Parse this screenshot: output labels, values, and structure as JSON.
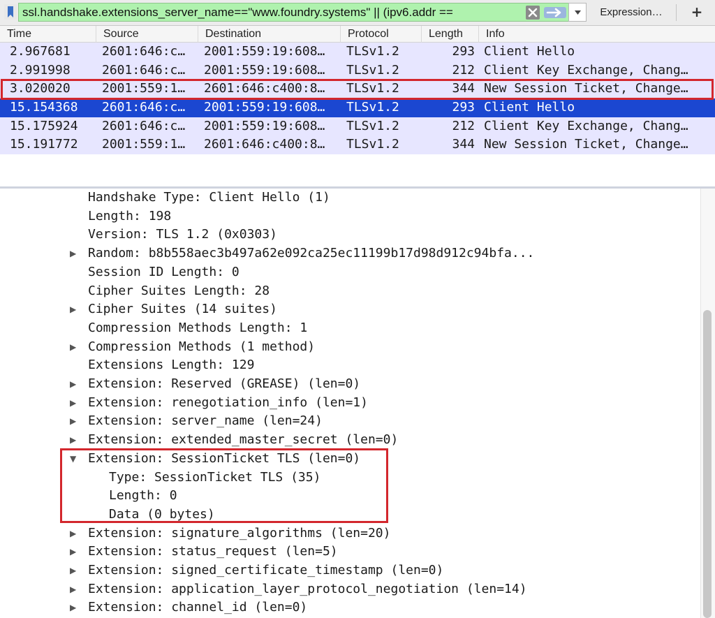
{
  "filter": {
    "value": "ssl.handshake.extensions_server_name==\"www.foundry.systems\" || (ipv6.addr ==",
    "expression_label": "Expression…",
    "add_label": "+"
  },
  "columns": [
    "Time",
    "Source",
    "Destination",
    "Protocol",
    "Length",
    "Info"
  ],
  "packets": [
    {
      "time": "2.967681",
      "source": "2601:646:c…",
      "destination": "2001:559:19:608…",
      "protocol": "TLSv1.2",
      "length": "293",
      "info": "Client Hello"
    },
    {
      "time": "2.991998",
      "source": "2601:646:c…",
      "destination": "2001:559:19:608…",
      "protocol": "TLSv1.2",
      "length": "212",
      "info": "Client Key Exchange, Chang…"
    },
    {
      "time": "3.020020",
      "source": "2001:559:1…",
      "destination": "2601:646:c400:8…",
      "protocol": "TLSv1.2",
      "length": "344",
      "info": "New Session Ticket, Change…"
    },
    {
      "time": "15.154368",
      "source": "2601:646:c…",
      "destination": "2001:559:19:608…",
      "protocol": "TLSv1.2",
      "length": "293",
      "info": "Client Hello"
    },
    {
      "time": "15.175924",
      "source": "2601:646:c…",
      "destination": "2001:559:19:608…",
      "protocol": "TLSv1.2",
      "length": "212",
      "info": "Client Key Exchange, Chang…"
    },
    {
      "time": "15.191772",
      "source": "2001:559:1…",
      "destination": "2601:646:c400:8…",
      "protocol": "TLSv1.2",
      "length": "344",
      "info": "New Session Ticket, Change…"
    }
  ],
  "selected_packet_index": 3,
  "highlighted_packet_index": 2,
  "details": [
    {
      "text": "Handshake Type: Client Hello (1)",
      "expander": "none",
      "indent": 0
    },
    {
      "text": "Length: 198",
      "expander": "none",
      "indent": 0
    },
    {
      "text": "Version: TLS 1.2 (0x0303)",
      "expander": "none",
      "indent": 0
    },
    {
      "text": "Random: b8b558aec3b497a62e092ca25ec11199b17d98d912c94bfa...",
      "expander": "collapsed",
      "indent": 0
    },
    {
      "text": "Session ID Length: 0",
      "expander": "none",
      "indent": 0
    },
    {
      "text": "Cipher Suites Length: 28",
      "expander": "none",
      "indent": 0
    },
    {
      "text": "Cipher Suites (14 suites)",
      "expander": "collapsed",
      "indent": 0
    },
    {
      "text": "Compression Methods Length: 1",
      "expander": "none",
      "indent": 0
    },
    {
      "text": "Compression Methods (1 method)",
      "expander": "collapsed",
      "indent": 0
    },
    {
      "text": "Extensions Length: 129",
      "expander": "none",
      "indent": 0
    },
    {
      "text": "Extension: Reserved (GREASE) (len=0)",
      "expander": "collapsed",
      "indent": 0
    },
    {
      "text": "Extension: renegotiation_info (len=1)",
      "expander": "collapsed",
      "indent": 0
    },
    {
      "text": "Extension: server_name (len=24)",
      "expander": "collapsed",
      "indent": 0
    },
    {
      "text": "Extension: extended_master_secret (len=0)",
      "expander": "collapsed",
      "indent": 0
    },
    {
      "text": "Extension: SessionTicket TLS (len=0)",
      "expander": "expanded",
      "indent": 0
    },
    {
      "text": "Type: SessionTicket TLS (35)",
      "expander": "none",
      "indent": 1
    },
    {
      "text": "Length: 0",
      "expander": "none",
      "indent": 1
    },
    {
      "text": "Data (0 bytes)",
      "expander": "none",
      "indent": 1
    },
    {
      "text": "Extension: signature_algorithms (len=20)",
      "expander": "collapsed",
      "indent": 0
    },
    {
      "text": "Extension: status_request (len=5)",
      "expander": "collapsed",
      "indent": 0
    },
    {
      "text": "Extension: signed_certificate_timestamp (len=0)",
      "expander": "collapsed",
      "indent": 0
    },
    {
      "text": "Extension: application_layer_protocol_negotiation (len=14)",
      "expander": "collapsed",
      "indent": 0
    },
    {
      "text": "Extension: channel_id (len=0)",
      "expander": "collapsed",
      "indent": 0
    }
  ],
  "icons": {
    "bookmark": "bookmark-icon",
    "clear": "clear-filter-icon",
    "apply": "apply-filter-arrow-icon",
    "dropdown": "chevron-down-icon",
    "collapsed": "triangle-right-icon",
    "expanded": "triangle-down-icon"
  },
  "colors": {
    "filter_valid": "#aff2ae",
    "row_tls": "#e7e6ff",
    "row_selected": "#1b47d1",
    "highlight_box": "#d3272d"
  }
}
